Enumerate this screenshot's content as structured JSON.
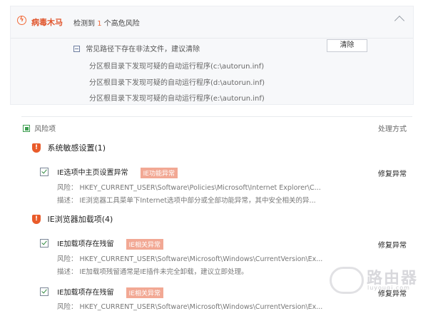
{
  "virus_section": {
    "title": "病毒木马",
    "detect_prefix": "检测到",
    "detect_count": "1",
    "detect_suffix": "个高危风险",
    "path_message": "常见路径下存在非法文件，建议清除",
    "clear_label": "清除",
    "autorun_items": [
      "分区根目录下发现可疑的自动运行程序(c:\\autorun.inf)",
      "分区根目录下发现可疑的自动运行程序(d:\\autorun.inf)",
      "分区根目录下发现可疑的自动运行程序(e:\\autorun.inf)"
    ]
  },
  "risk_list": {
    "header": "风险项",
    "process_header": "处理方式",
    "categories": [
      {
        "label": "系统敏感设置(1)"
      },
      {
        "label": "IE浏览器加载项(4)"
      }
    ],
    "items": [
      {
        "title": "IE选项中主页设置异常",
        "tag": "IE功能异常",
        "action": "修复异常",
        "risk": "风险： HKEY_CURRENT_USER\\Software\\Policies\\Microsoft\\Internet Explorer\\C...",
        "desc": "描述： IE浏览器工具菜单下Internet选项中部分或全部功能异常，其中安全相关的异..."
      },
      {
        "title": "IE加载项存在残留",
        "tag": "IE相关异常",
        "action": "修复异常",
        "risk": "风险： HKEY_CURRENT_USER\\Software\\Microsoft\\Windows\\CurrentVersion\\Ex...",
        "desc": "描述： IE加载项残留通常是IE插件未完全卸载，建议立即处理。"
      },
      {
        "title": "IE加载项存在残留",
        "tag": "IE相关异常",
        "action": "修复异常",
        "risk": "风险： HKEY_CURRENT_USER\\Software\\Microsoft\\Windows\\CurrentVersion\\Ex..."
      }
    ]
  },
  "watermark": {
    "text": "路由器",
    "sub": "luyouqi.com"
  },
  "colors": {
    "accent": "#e0542b",
    "tag": "#f2a894",
    "check": "#2f8a3f"
  }
}
